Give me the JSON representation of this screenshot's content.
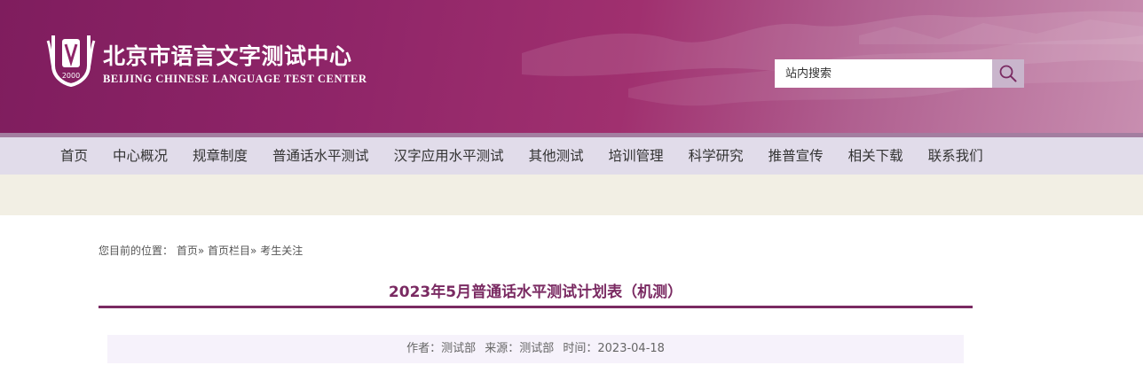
{
  "header": {
    "site_title": "北京市语言文字测试中心",
    "site_subtitle": "BEIJING  CHINESE  LANGUAGE TEST CENTER",
    "logo_caption": "2000"
  },
  "search": {
    "placeholder": "站内搜索",
    "value": ""
  },
  "nav": {
    "items": [
      {
        "label": "首页"
      },
      {
        "label": "中心概况"
      },
      {
        "label": "规章制度"
      },
      {
        "label": "普通话水平测试"
      },
      {
        "label": "汉字应用水平测试"
      },
      {
        "label": "其他测试"
      },
      {
        "label": "培训管理"
      },
      {
        "label": "科学研究"
      },
      {
        "label": "推普宣传"
      },
      {
        "label": "相关下载"
      },
      {
        "label": "联系我们"
      }
    ]
  },
  "breadcrumb": {
    "prefix": "您目前的位置：",
    "links": [
      "首页»",
      "首页栏目»",
      "考生关注"
    ]
  },
  "article": {
    "title": "2023年5月普通话水平测试计划表（机测）",
    "author": "作者：测试部",
    "source": "来源：测试部",
    "time": "时间：2023-04-18"
  },
  "colors": {
    "brand": "#8f2568",
    "nav_bg": "#e1dcea",
    "title": "#7a2a62"
  }
}
